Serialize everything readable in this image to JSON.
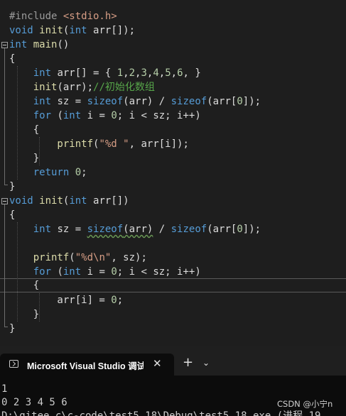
{
  "editor": {
    "lines": [
      [
        [
          "pp",
          "#include "
        ],
        [
          "inc",
          "<stdio.h>"
        ]
      ],
      [
        [
          "kw",
          "void "
        ],
        [
          "fn",
          "init"
        ],
        [
          "",
          "("
        ],
        [
          "kw",
          "int "
        ],
        [
          "",
          "arr[]);"
        ]
      ],
      [
        [
          "kw",
          "int "
        ],
        [
          "fn",
          "main"
        ],
        [
          "",
          "()"
        ]
      ],
      [
        [
          "",
          "{"
        ]
      ],
      [
        [
          "kw",
          "    int "
        ],
        [
          "",
          "arr[] = { "
        ],
        [
          "num",
          "1"
        ],
        [
          "",
          ","
        ],
        [
          "num",
          "2"
        ],
        [
          "",
          ","
        ],
        [
          "num",
          "3"
        ],
        [
          "",
          ","
        ],
        [
          "num",
          "4"
        ],
        [
          "",
          ","
        ],
        [
          "num",
          "5"
        ],
        [
          "",
          ","
        ],
        [
          "num",
          "6"
        ],
        [
          "",
          ", }"
        ]
      ],
      [
        [
          "fn",
          "    init"
        ],
        [
          "",
          "(arr);"
        ],
        [
          "cm",
          "//初始化数组"
        ]
      ],
      [
        [
          "kw",
          "    int "
        ],
        [
          "",
          "sz = "
        ],
        [
          "kw",
          "sizeof"
        ],
        [
          "",
          "(arr) / "
        ],
        [
          "kw",
          "sizeof"
        ],
        [
          "",
          "(arr["
        ],
        [
          "num",
          "0"
        ],
        [
          "",
          "]);"
        ]
      ],
      [
        [
          "kw",
          "    for "
        ],
        [
          "",
          "("
        ],
        [
          "kw",
          "int "
        ],
        [
          "",
          "i = "
        ],
        [
          "num",
          "0"
        ],
        [
          "",
          "; i < sz; i++)"
        ]
      ],
      [
        [
          "",
          "    {"
        ]
      ],
      [
        [
          "fn",
          "        printf"
        ],
        [
          "",
          "("
        ],
        [
          "str",
          "\"%d \""
        ],
        [
          "",
          ", arr[i]);"
        ]
      ],
      [
        [
          "",
          "    }"
        ]
      ],
      [
        [
          "kw",
          "    return "
        ],
        [
          "num",
          "0"
        ],
        [
          "",
          ";"
        ]
      ],
      [
        [
          "",
          "}"
        ]
      ],
      [
        [
          "kw",
          "void "
        ],
        [
          "fn",
          "init"
        ],
        [
          "",
          "("
        ],
        [
          "kw",
          "int "
        ],
        [
          "",
          "arr[])"
        ]
      ],
      [
        [
          "",
          "{"
        ]
      ],
      [
        [
          "kw",
          "    int "
        ],
        [
          "",
          "sz = "
        ],
        [
          "kwu",
          "sizeof"
        ],
        [
          "u",
          "(arr)"
        ],
        [
          "",
          " / "
        ],
        [
          "kw",
          "sizeof"
        ],
        [
          "",
          "(arr["
        ],
        [
          "num",
          "0"
        ],
        [
          "",
          "]);"
        ]
      ],
      [
        [
          "",
          ""
        ]
      ],
      [
        [
          "fn",
          "    printf"
        ],
        [
          "",
          "("
        ],
        [
          "str",
          "\"%d\\n\""
        ],
        [
          "",
          ", sz);"
        ]
      ],
      [
        [
          "kw",
          "    for "
        ],
        [
          "",
          "("
        ],
        [
          "kw",
          "int "
        ],
        [
          "",
          "i = "
        ],
        [
          "num",
          "0"
        ],
        [
          "",
          "; i < sz; i++)"
        ]
      ],
      [
        [
          "",
          "    {"
        ]
      ],
      [
        [
          "",
          "        arr[i] = "
        ],
        [
          "num",
          "0"
        ],
        [
          "",
          ";"
        ]
      ],
      [
        [
          "",
          "    }"
        ]
      ],
      [
        [
          "",
          "}"
        ]
      ]
    ]
  },
  "terminal": {
    "tab_title": "Microsoft Visual Studio 调试控制台",
    "close_glyph": "✕",
    "new_tab_glyph": "+",
    "dropdown_glyph": "⌄",
    "output": [
      "1",
      "0 2 3 4 5 6",
      "D:\\gitee.c\\c-code\\test5_18\\Debug\\test5_18.exe (进程 19"
    ],
    "watermark": "CSDN @小宁n"
  },
  "colors": {
    "editor_bg": "#1e1e1e",
    "keyword": "#569cd6",
    "function": "#dcdcaa",
    "string": "#d69d85",
    "number": "#b5cea8",
    "comment": "#57a64a",
    "terminal_bg": "#0c0c0c"
  }
}
